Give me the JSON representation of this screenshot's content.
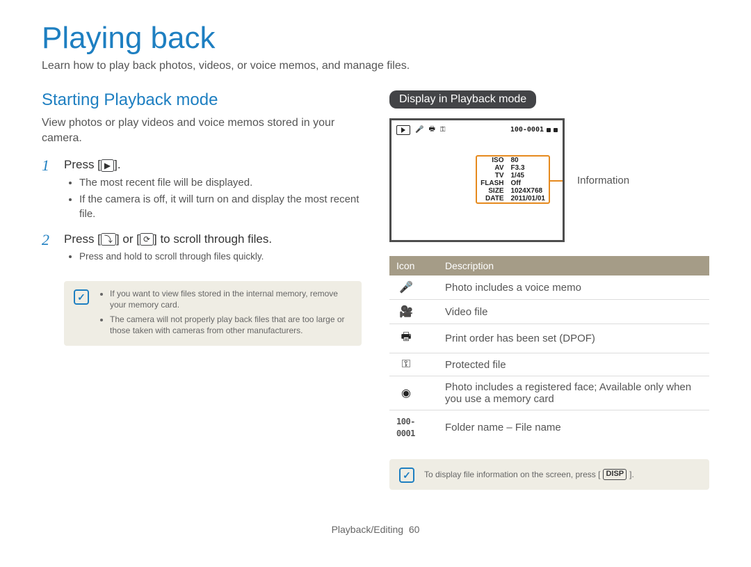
{
  "page": {
    "title": "Playing back",
    "intro": "Learn how to play back photos, videos, or voice memos, and manage files.",
    "footer_section": "Playback/Editing",
    "footer_page": "60"
  },
  "left": {
    "subhead": "Starting Playback mode",
    "desc": "View photos or play videos and voice memos stored in your camera.",
    "step1_num": "1",
    "step1_main_a": "Press [",
    "step1_main_b": "].",
    "step1_icon": "▶",
    "step1_b1": "The most recent file will be displayed.",
    "step1_b2": "If the camera is off, it will turn on and display the most recent file.",
    "step2_num": "2",
    "step2_main_a": "Press [",
    "step2_icon1": "⤵",
    "step2_main_b": "] or [",
    "step2_icon2": "⟳",
    "step2_main_c": "] to scroll through files.",
    "step2_b1": "Press and hold to scroll through files quickly.",
    "note1": "If you want to view files stored in the internal memory, remove your memory card.",
    "note2": "The camera will not properly play back files that are too large or those taken with cameras from other manufacturers."
  },
  "right": {
    "pill": "Display in Playback mode",
    "info_label": "Information",
    "lcd": {
      "folder": "100-0001",
      "iso_lbl": "ISO",
      "iso_val": "80",
      "av_lbl": "AV",
      "av_val": "F3.3",
      "tv_lbl": "TV",
      "tv_val": "1/45",
      "flash_lbl": "FLASH",
      "flash_val": "Off",
      "size_lbl": "SIZE",
      "size_val": "1024X768",
      "date_lbl": "DATE",
      "date_val": "2011/01/01"
    },
    "table": {
      "h1": "Icon",
      "h2": "Description",
      "r1": "Photo includes a voice memo",
      "r2": "Video file",
      "r3": "Print order has been set (DPOF)",
      "r4": "Protected file",
      "r5": "Photo includes a registered face; Available only when you use a memory card",
      "r6_code": "100-0001",
      "r6": "Folder name – File name"
    },
    "tip_a": "To display file information on the screen, press [",
    "tip_btn": "DISP",
    "tip_b": "]."
  }
}
